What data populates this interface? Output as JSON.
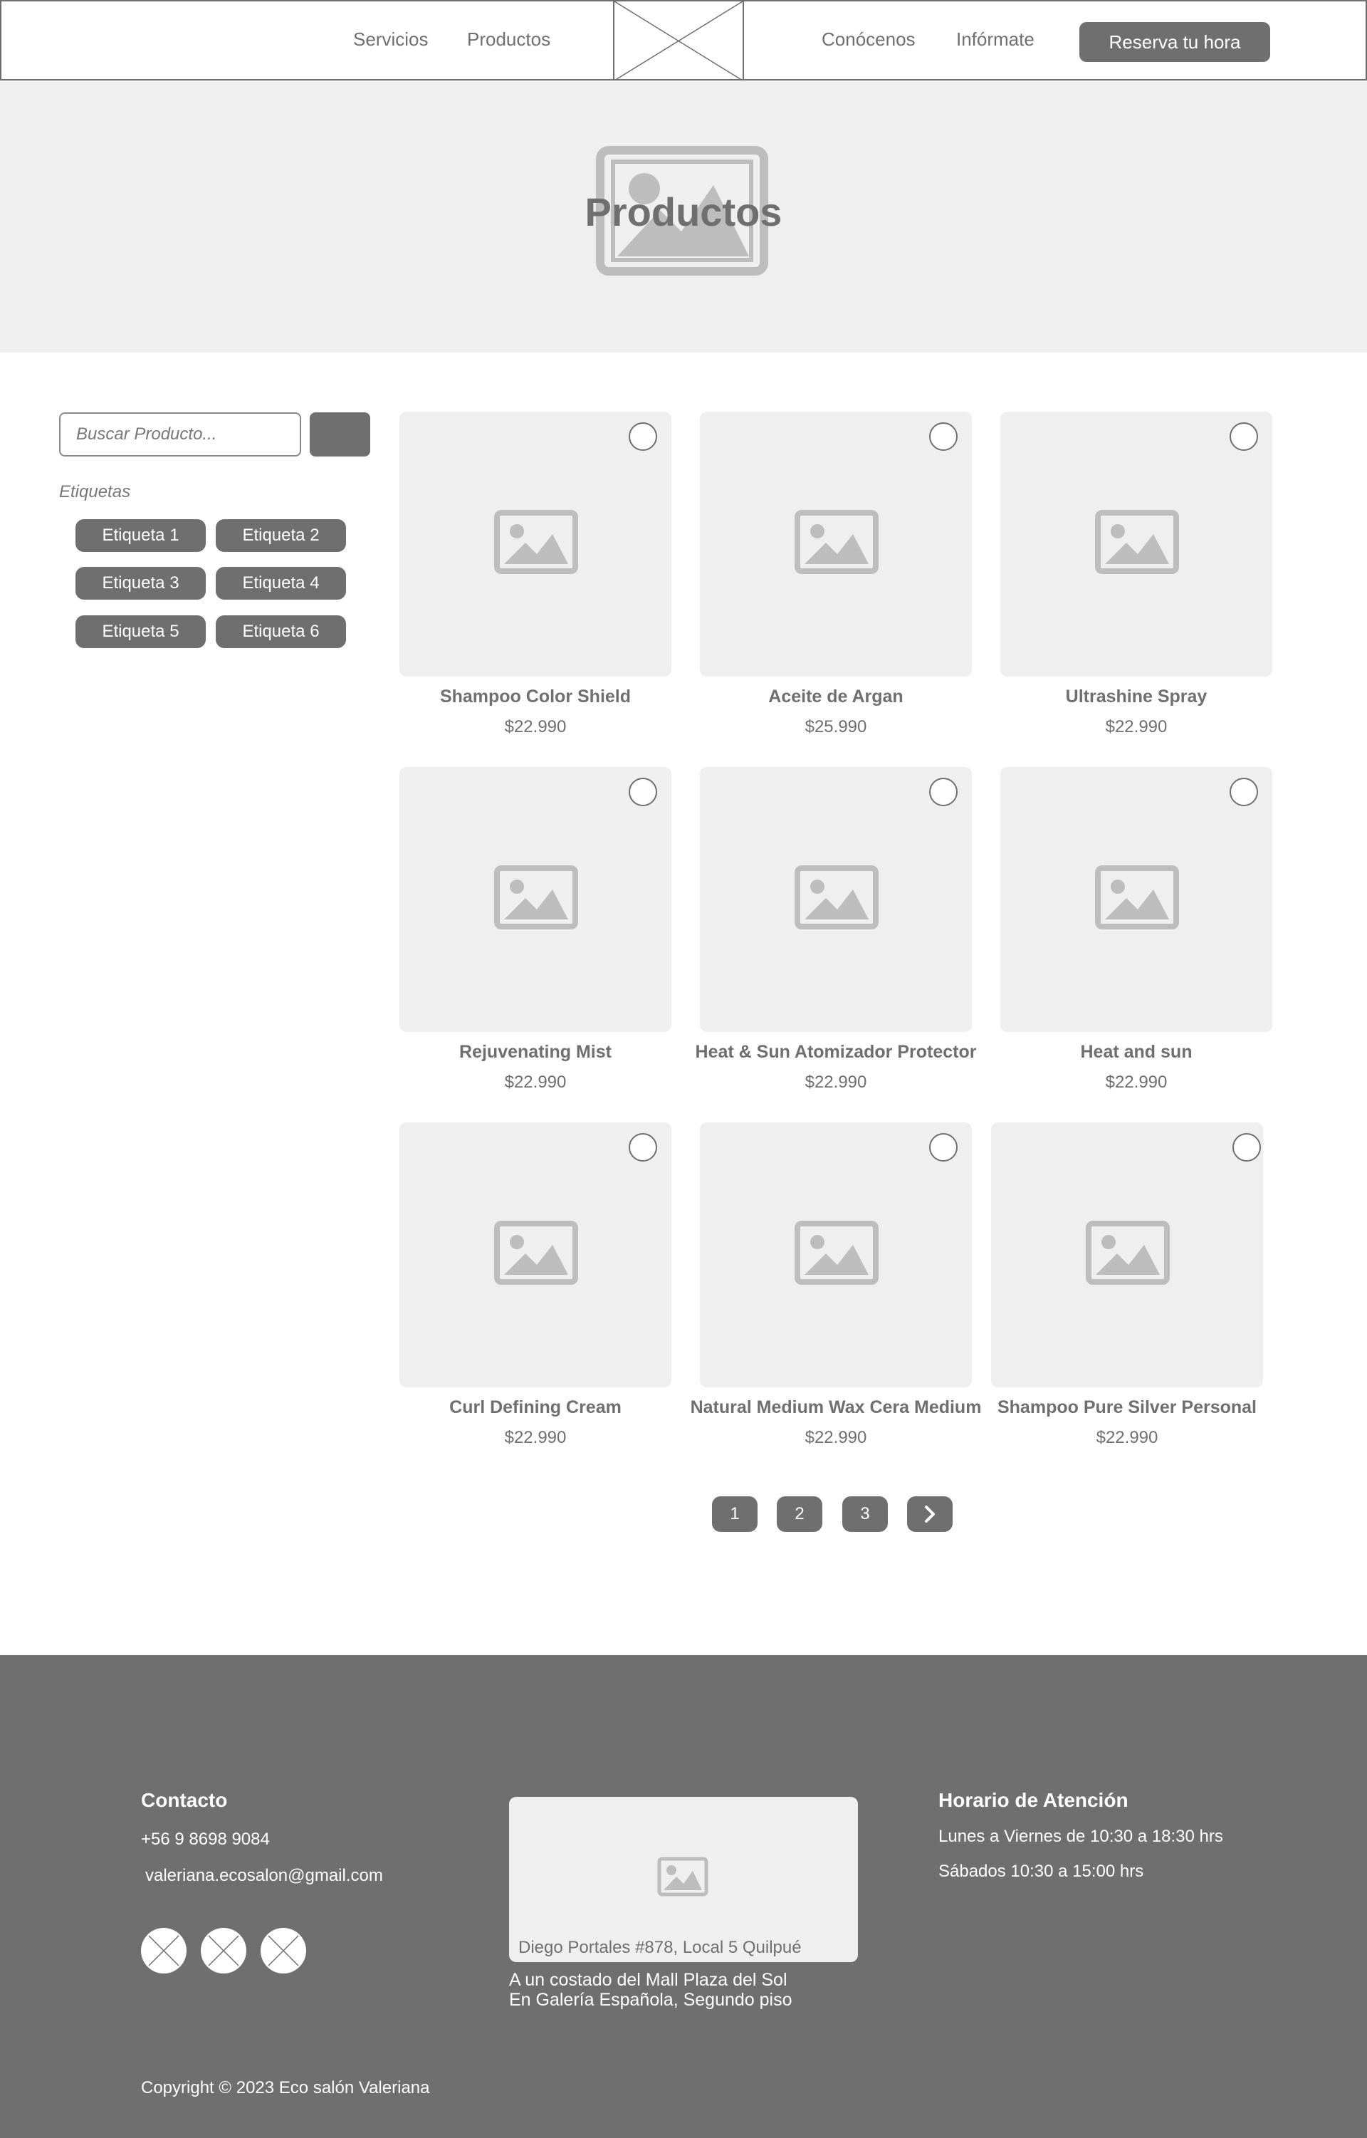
{
  "nav": {
    "links": [
      "Servicios",
      "Productos",
      "Conócenos",
      "Infórmate"
    ],
    "cta": "Reserva tu hora"
  },
  "hero": {
    "title": "Productos"
  },
  "sidebar": {
    "search_placeholder": "Buscar Producto...",
    "tags_heading": "Etiquetas",
    "tags": [
      "Etiqueta 1",
      "Etiqueta 2",
      "Etiqueta 3",
      "Etiqueta 4",
      "Etiqueta 5",
      "Etiqueta 6"
    ]
  },
  "products": [
    {
      "name": "Shampoo Color Shield",
      "price": "$22.990"
    },
    {
      "name": "Aceite de Argan",
      "price": "$25.990"
    },
    {
      "name": "Ultrashine Spray",
      "price": "$22.990"
    },
    {
      "name": "Rejuvenating Mist",
      "price": "$22.990"
    },
    {
      "name": "Heat & Sun Atomizador Protector",
      "price": "$22.990"
    },
    {
      "name": "Heat and sun",
      "price": "$22.990"
    },
    {
      "name": "Curl Defining Cream",
      "price": "$22.990"
    },
    {
      "name": "Natural Medium Wax Cera Medium",
      "price": "$22.990"
    },
    {
      "name": "Shampoo Pure Silver Personal",
      "price": "$22.990"
    }
  ],
  "pagination": {
    "pages": [
      "1",
      "2",
      "3"
    ],
    "next_icon": "chevron-right-icon"
  },
  "footer": {
    "contact_heading": "Contacto",
    "phone": "+56 9 8698 9084",
    "email": "valeriana.ecosalon@gmail.com",
    "address": "Diego Portales #878, Local 5 Quilpué",
    "address_note_1": "A un costado del Mall Plaza del Sol",
    "address_note_2": "En Galería Española, Segundo piso",
    "hours_heading": "Horario de Atención",
    "hours_1": "Lunes a Viernes de 10:30 a 18:30 hrs",
    "hours_2": "Sábados 10:30 a 15:00 hrs",
    "copyright": "Copyright © 2023 Eco salón Valeriana"
  },
  "colors": {
    "primary": "#6f6f6f",
    "placeholder_bg": "#efefef",
    "icon_gray": "#bdbdbd",
    "footer_text": "#ffffff"
  }
}
